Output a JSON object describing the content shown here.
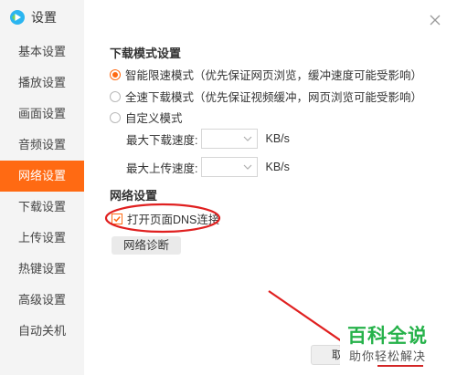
{
  "window": {
    "title": "设置"
  },
  "sidebar": {
    "items": [
      {
        "label": "基本设置"
      },
      {
        "label": "播放设置"
      },
      {
        "label": "画面设置"
      },
      {
        "label": "音频设置"
      },
      {
        "label": "网络设置",
        "active": true
      },
      {
        "label": "下载设置"
      },
      {
        "label": "上传设置"
      },
      {
        "label": "热键设置"
      },
      {
        "label": "高级设置"
      },
      {
        "label": "自动关机"
      }
    ]
  },
  "download_mode": {
    "heading": "下载模式设置",
    "options": [
      {
        "label": "智能限速模式（优先保证网页浏览，缓冲速度可能受影响）",
        "selected": true
      },
      {
        "label": "全速下载模式（优先保证视频缓冲，网页浏览可能受影响）",
        "selected": false
      },
      {
        "label": "自定义模式",
        "selected": false
      }
    ],
    "max_download_label": "最大下载速度:",
    "max_upload_label": "最大上传速度:",
    "unit": "KB/s"
  },
  "network": {
    "heading": "网络设置",
    "dns_label": "打开页面DNS连接",
    "dns_checked": true,
    "diagnose_button": "网络诊断"
  },
  "footer": {
    "partial_button_label": "取"
  },
  "watermark": {
    "title": "百科全说",
    "subtitle": "助你轻松解决"
  },
  "colors": {
    "accent": "#ff6a13",
    "annotation": "#e02020",
    "watermark_green": "#26b24a"
  }
}
